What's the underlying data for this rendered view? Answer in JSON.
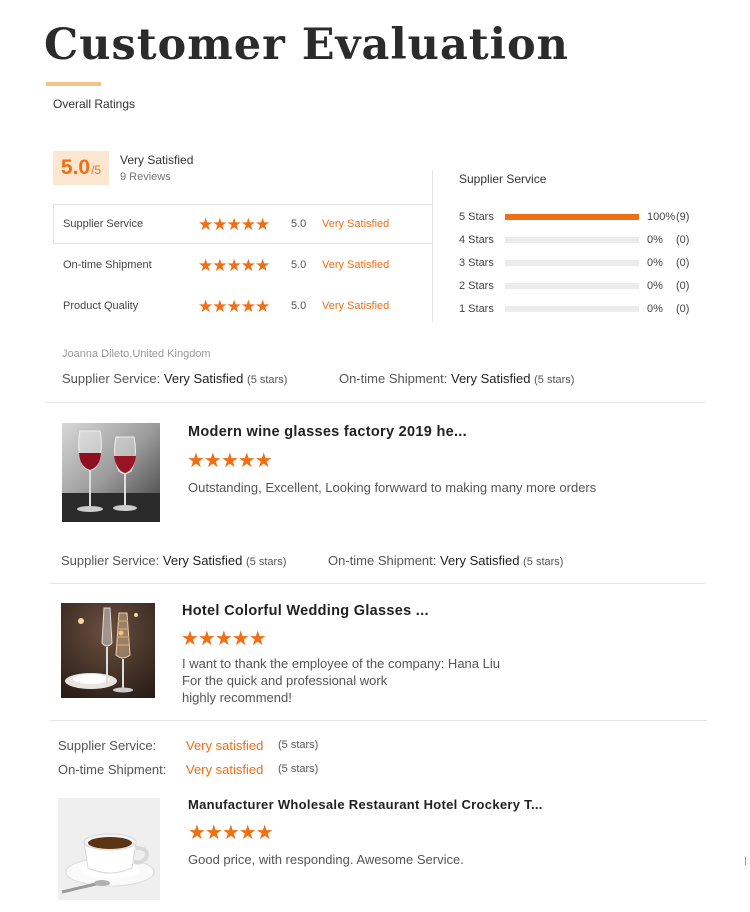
{
  "page": {
    "title": "Customer Evaluation",
    "section_label": "Overall Ratings"
  },
  "overall": {
    "score": "5.0",
    "out_of": "/5",
    "satisfaction": "Very Satisfied",
    "reviews": "9 Reviews"
  },
  "categories": [
    {
      "label": "Supplier Service",
      "stars": "★★★★★",
      "rating": 5.0,
      "score": "5.0",
      "text": "Very Satisfied"
    },
    {
      "label": "On-time Shipment",
      "stars": "★★★★★",
      "rating": 5.0,
      "score": "5.0",
      "text": "Very Satisfied"
    },
    {
      "label": "Product Quality",
      "stars": "★★★★★",
      "rating": 5.0,
      "score": "5.0",
      "text": "Very Satisfied"
    }
  ],
  "distribution": {
    "title": "Supplier Service",
    "rows": [
      {
        "label": "5 Stars",
        "fraction": 1.0,
        "pct": "100%",
        "count": "(9)"
      },
      {
        "label": "4 Stars",
        "fraction": 0.0,
        "pct": "0%",
        "count": "(0)"
      },
      {
        "label": "3 Stars",
        "fraction": 0.0,
        "pct": "0%",
        "count": "(0)"
      },
      {
        "label": "2 Stars",
        "fraction": 0.0,
        "pct": "0%",
        "count": "(0)"
      },
      {
        "label": "1 Stars",
        "fraction": 0.0,
        "pct": "0%",
        "count": "(0)"
      }
    ]
  },
  "reviews": [
    {
      "reviewer": "Joanna Dileto,United Kingdom",
      "supplier_label": "Supplier Service:",
      "supplier_value": "Very Satisfied",
      "supplier_stars": "(5 stars)",
      "shipment_label": "On-time Shipment:",
      "shipment_value": "Very Satisfied",
      "shipment_stars": "(5 stars)",
      "product_title": "Modern wine glasses factory 2019 he...",
      "stars": "★★★★★",
      "rating": 5,
      "text": "Outstanding, Excellent, Looking forwward to making many more orders"
    },
    {
      "supplier_label": "Supplier Service:",
      "supplier_value": "Very Satisfied",
      "supplier_stars": "(5 stars)",
      "shipment_label": "On-time Shipment:",
      "shipment_value": "Very Satisfied",
      "shipment_stars": "(5 stars)",
      "product_title": "Hotel Colorful Wedding Glasses ...",
      "stars": "★★★★★",
      "rating": 5,
      "text_lines": [
        "I want to thank the employee of the company: Hana Liu",
        "For the quick and professional work",
        "highly recommend!"
      ]
    },
    {
      "supplier_label": "Supplier Service:",
      "supplier_value": "Very satisfied",
      "supplier_stars": "(5 stars)",
      "shipment_label": "On-time Shipment:",
      "shipment_value": "Very satisfied",
      "shipment_stars": "(5 stars)",
      "product_title": "Manufacturer Wholesale Restaurant Hotel Crockery T...",
      "stars": "★★★★★",
      "rating": 5,
      "text": "Good price, with responding. Awesome Service."
    }
  ],
  "colors": {
    "accent": "#f06e14",
    "score_bg": "#fde6d0",
    "title_underline": "#f3c28a",
    "divider": "#e4e4e4"
  }
}
